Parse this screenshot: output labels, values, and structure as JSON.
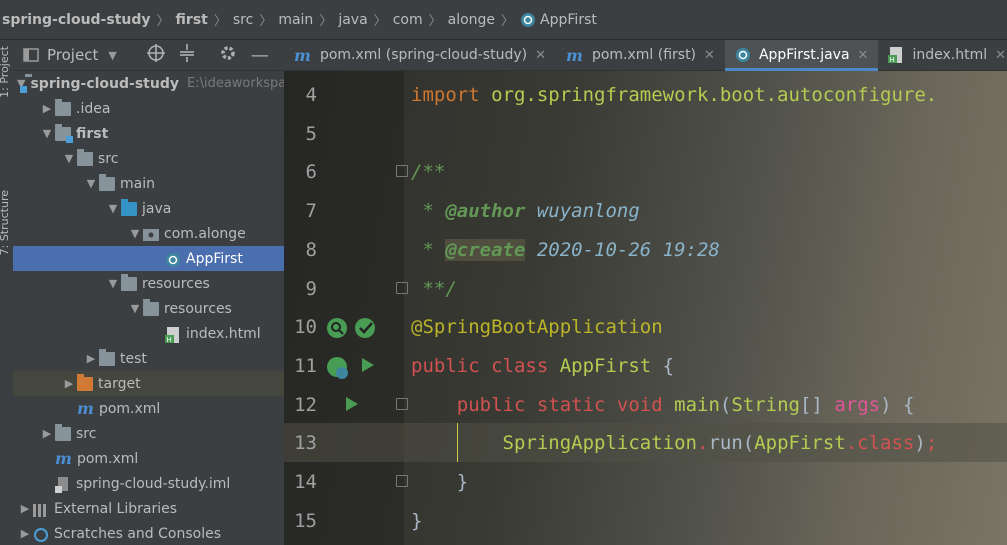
{
  "breadcrumb": {
    "items": [
      "spring-cloud-study",
      "first",
      "src",
      "main",
      "java",
      "com",
      "alonge",
      "AppFirst"
    ],
    "separator": "〉"
  },
  "toolstrip": {
    "project_tab": "1: Project",
    "structure_tab": "7: Structure"
  },
  "project_panel": {
    "title": "Project",
    "tree": [
      {
        "label": "spring-cloud-study",
        "extra": "E:\\ideaworkspa",
        "type": "module",
        "depth": 0,
        "arrow": "open",
        "bold": true
      },
      {
        "label": ".idea",
        "type": "folder",
        "depth": 1,
        "arrow": "closed"
      },
      {
        "label": "first",
        "type": "module",
        "depth": 1,
        "arrow": "open",
        "bold": true
      },
      {
        "label": "src",
        "type": "folder",
        "depth": 2,
        "arrow": "open"
      },
      {
        "label": "main",
        "type": "folder",
        "depth": 3,
        "arrow": "open"
      },
      {
        "label": "java",
        "type": "folder-blue",
        "depth": 4,
        "arrow": "open"
      },
      {
        "label": "com.alonge",
        "type": "package",
        "depth": 5,
        "arrow": "open"
      },
      {
        "label": "AppFirst",
        "type": "class",
        "depth": 6,
        "arrow": "none",
        "selected": true
      },
      {
        "label": "resources",
        "type": "folder-res",
        "depth": 4,
        "arrow": "open"
      },
      {
        "label": "resources",
        "type": "folder",
        "depth": 5,
        "arrow": "open"
      },
      {
        "label": "index.html",
        "type": "html",
        "depth": 6,
        "arrow": "none"
      },
      {
        "label": "test",
        "type": "folder",
        "depth": 3,
        "arrow": "closed"
      },
      {
        "label": "target",
        "type": "folder-orange",
        "depth": 2,
        "arrow": "closed",
        "highlight": true
      },
      {
        "label": "pom.xml",
        "type": "maven",
        "depth": 2,
        "arrow": "none"
      },
      {
        "label": "src",
        "type": "folder",
        "depth": 1,
        "arrow": "closed"
      },
      {
        "label": "pom.xml",
        "type": "maven",
        "depth": 1,
        "arrow": "none"
      },
      {
        "label": "spring-cloud-study.iml",
        "type": "iml",
        "depth": 1,
        "arrow": "none"
      },
      {
        "label": "External Libraries",
        "type": "libs",
        "depth": 0,
        "arrow": "closed"
      },
      {
        "label": "Scratches and Consoles",
        "type": "scratch",
        "depth": 0,
        "arrow": "closed"
      }
    ]
  },
  "editor_tabs": [
    {
      "label": "pom.xml (spring-cloud-study)",
      "icon": "maven-icon",
      "active": false
    },
    {
      "label": "pom.xml (first)",
      "icon": "maven-icon",
      "active": false
    },
    {
      "label": "AppFirst.java",
      "icon": "spring-class-icon",
      "active": true
    },
    {
      "label": "index.html",
      "icon": "html-file-icon",
      "active": false
    }
  ],
  "editor": {
    "lines": [
      {
        "num": "4",
        "tokens": [
          [
            "kw",
            "import "
          ],
          [
            "yellow",
            "org.springframework.boot.autoconfigure."
          ]
        ]
      },
      {
        "num": "5",
        "tokens": []
      },
      {
        "num": "6",
        "tokens": [
          [
            "cm",
            "/**"
          ]
        ]
      },
      {
        "num": "7",
        "tokens": [
          [
            "cm",
            " * "
          ],
          [
            "cmtag",
            "@author"
          ],
          [
            "cmval",
            " wuyanlong"
          ]
        ]
      },
      {
        "num": "8",
        "tokens": [
          [
            "cm",
            " * "
          ],
          [
            "cmtag",
            "@create"
          ],
          [
            "cmval",
            " 2020-10-26 19:28"
          ]
        ]
      },
      {
        "num": "9",
        "tokens": [
          [
            "cm",
            " **/"
          ]
        ]
      },
      {
        "num": "10",
        "tokens": [
          [
            "ann",
            "@SpringBootApplication"
          ]
        ]
      },
      {
        "num": "11",
        "tokens": [
          [
            "red",
            "public "
          ],
          [
            "red",
            "class "
          ],
          [
            "yellow",
            "AppFirst"
          ],
          [
            "par",
            " {"
          ]
        ]
      },
      {
        "num": "12",
        "tokens": [
          [
            "red",
            "    public "
          ],
          [
            "red",
            "static "
          ],
          [
            "red",
            "void "
          ],
          [
            "yellow",
            "main"
          ],
          [
            "par",
            "("
          ],
          [
            "yellow",
            "String"
          ],
          [
            "par",
            "[] "
          ],
          [
            "pink",
            "args"
          ],
          [
            "par",
            ") {"
          ]
        ]
      },
      {
        "num": "13",
        "tokens": [
          [
            "yellow",
            "        SpringApplication"
          ],
          [
            "red",
            "."
          ],
          [
            "par",
            "run("
          ],
          [
            "yellow",
            "AppFirst"
          ],
          [
            "red",
            ".class"
          ],
          [
            "par",
            ")"
          ],
          [
            "red",
            ";"
          ]
        ]
      },
      {
        "num": "14",
        "tokens": [
          [
            "par",
            "    }"
          ]
        ]
      },
      {
        "num": "15",
        "tokens": [
          [
            "par",
            "}"
          ]
        ]
      }
    ],
    "current_line": "13"
  },
  "colors": {
    "selection": "#4b6eaf",
    "keyword": "#cc7832",
    "annotation": "#bbb529",
    "comment": "#629755",
    "run_green": "#499c54"
  }
}
